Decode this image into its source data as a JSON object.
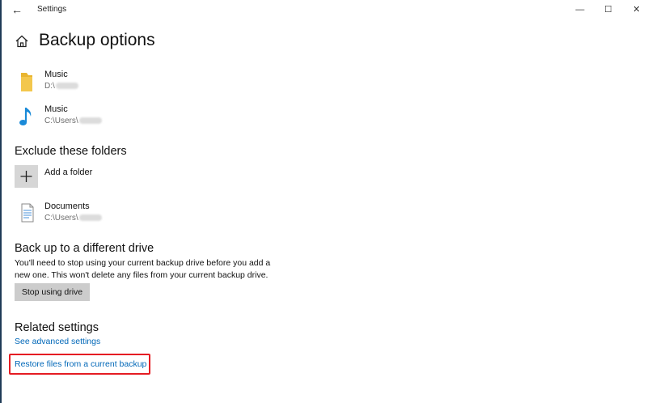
{
  "window": {
    "title": "Settings",
    "back_glyph": "←",
    "minimize_glyph": "—",
    "maximize_glyph": "☐",
    "close_glyph": "✕"
  },
  "page": {
    "title": "Backup options"
  },
  "backup_folders": [
    {
      "name": "Music",
      "path": "D:\\",
      "icon": "folder-icon"
    },
    {
      "name": "Music",
      "path": "C:\\Users\\",
      "icon": "music-note-icon"
    }
  ],
  "exclude": {
    "heading": "Exclude these folders",
    "add_label": "Add a folder",
    "items": [
      {
        "name": "Documents",
        "path": "C:\\Users\\",
        "icon": "document-icon"
      }
    ]
  },
  "different_drive": {
    "heading": "Back up to a different drive",
    "description": "You'll need to stop using your current backup drive before you add a new one. This won't delete any files from your current backup drive.",
    "button_label": "Stop using drive"
  },
  "related": {
    "heading": "Related settings",
    "links": [
      "See advanced settings",
      "Restore files from a current backup"
    ]
  },
  "colors": {
    "accent": "#0067b8",
    "highlight_border": "#e51c23",
    "button_bg": "#cccccc",
    "folder_yellow": "#f3c74d",
    "music_blue": "#1a8ad8"
  }
}
